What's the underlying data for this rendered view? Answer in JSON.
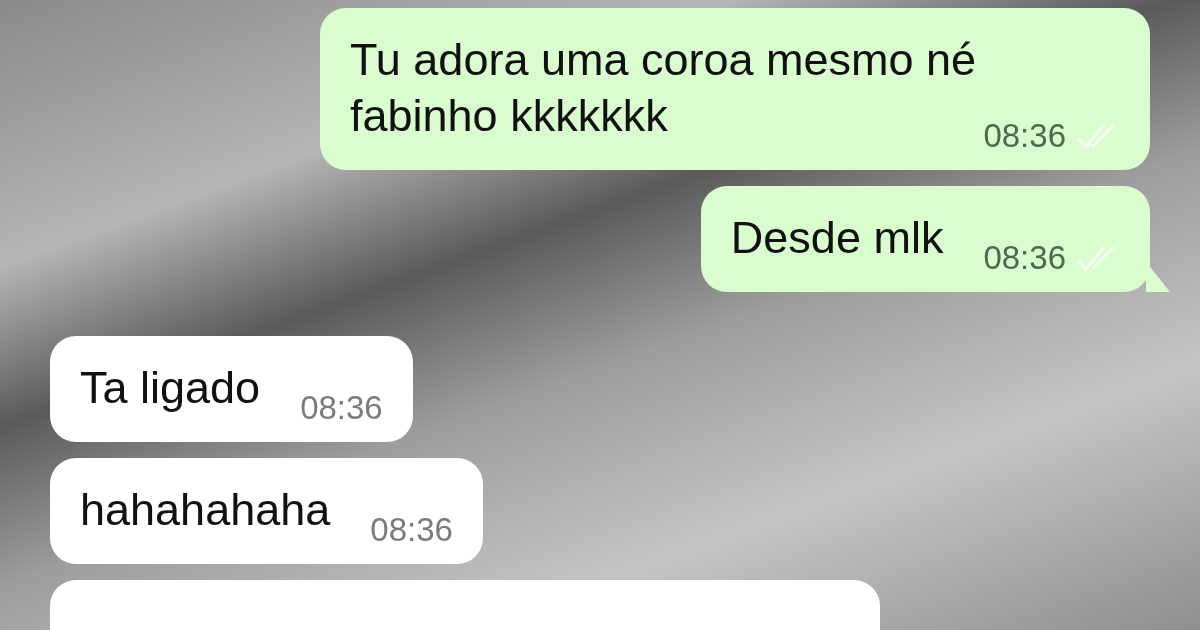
{
  "messages": [
    {
      "outgoing": true,
      "kind": "text",
      "text": "Tu adora uma coroa mesmo né fabinho kkkkkkk",
      "time": "08:36",
      "read": false,
      "tail": false
    },
    {
      "outgoing": true,
      "kind": "text",
      "text": "Desde mlk",
      "time": "08:36",
      "read": false,
      "tail": true
    },
    {
      "outgoing": false,
      "kind": "text",
      "text": "Ta ligado",
      "time": "08:36",
      "tail": false
    },
    {
      "outgoing": false,
      "kind": "text",
      "text": "hahahahaha",
      "time": "08:36",
      "tail": false
    },
    {
      "outgoing": false,
      "kind": "partial",
      "tail": false
    }
  ]
}
